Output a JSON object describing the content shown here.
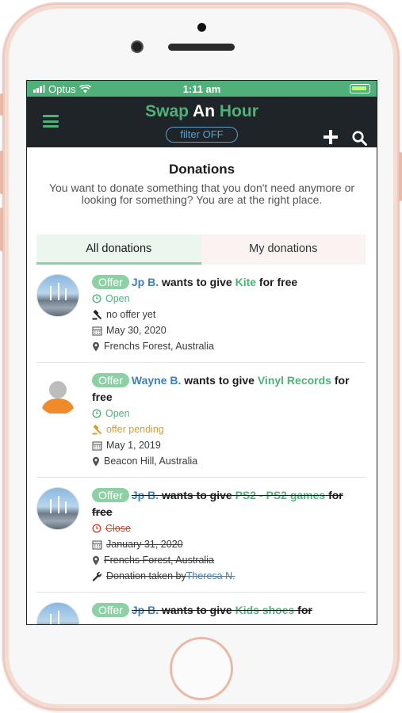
{
  "statusbar": {
    "carrier": "Optus",
    "time": "1:11 am"
  },
  "app": {
    "title_part1": "Swap",
    "title_part2": "An",
    "title_part3": "Hour",
    "filter_label": "filter OFF"
  },
  "page": {
    "title": "Donations",
    "description": "You want to donate something that you don't need anymore or looking for something? You are at the right place."
  },
  "tabs": [
    {
      "label": "All donations",
      "active": true
    },
    {
      "label": "My donations",
      "active": false
    }
  ],
  "donations": [
    {
      "badge": "Offer",
      "user": "Jp B.",
      "verb": " wants to give ",
      "item": "Kite",
      "suffix": " for free",
      "status": "Open",
      "offer_state": "no offer yet",
      "date": "May 30, 2020",
      "location": "Frenchs Forest, Australia"
    },
    {
      "badge": "Offer",
      "user": "Wayne B.",
      "verb": " wants to give ",
      "item": "Vinyl Records",
      "suffix": " for free",
      "status": "Open",
      "offer_state": "offer pending",
      "date": "May 1, 2019",
      "location": "Beacon Hill, Australia"
    },
    {
      "badge": "Offer",
      "user": "Jp B.",
      "verb": " wants to give ",
      "item": "PS2 - PS2 games",
      "suffix": " for free",
      "status": "Close",
      "date": "January 31, 2020",
      "location": "Frenchs Forest, Australia",
      "taken_prefix": "Donation taken by ",
      "taken_by": "Theresa N."
    },
    {
      "badge": "Offer",
      "user": "Jp B.",
      "verb": " wants to give ",
      "item": "Kids shoes",
      "suffix": " for"
    }
  ],
  "colors": {
    "brand_green": "#4fb07a",
    "navbar": "#1f2428",
    "link_blue": "#3d7fb8",
    "pending_orange": "#e29b2a",
    "closed_red": "#d2432e"
  },
  "icons": [
    "menu-icon",
    "plus-icon",
    "search-icon",
    "clock-icon",
    "gavel-icon",
    "calendar-icon",
    "map-pin-icon",
    "wrench-icon"
  ]
}
